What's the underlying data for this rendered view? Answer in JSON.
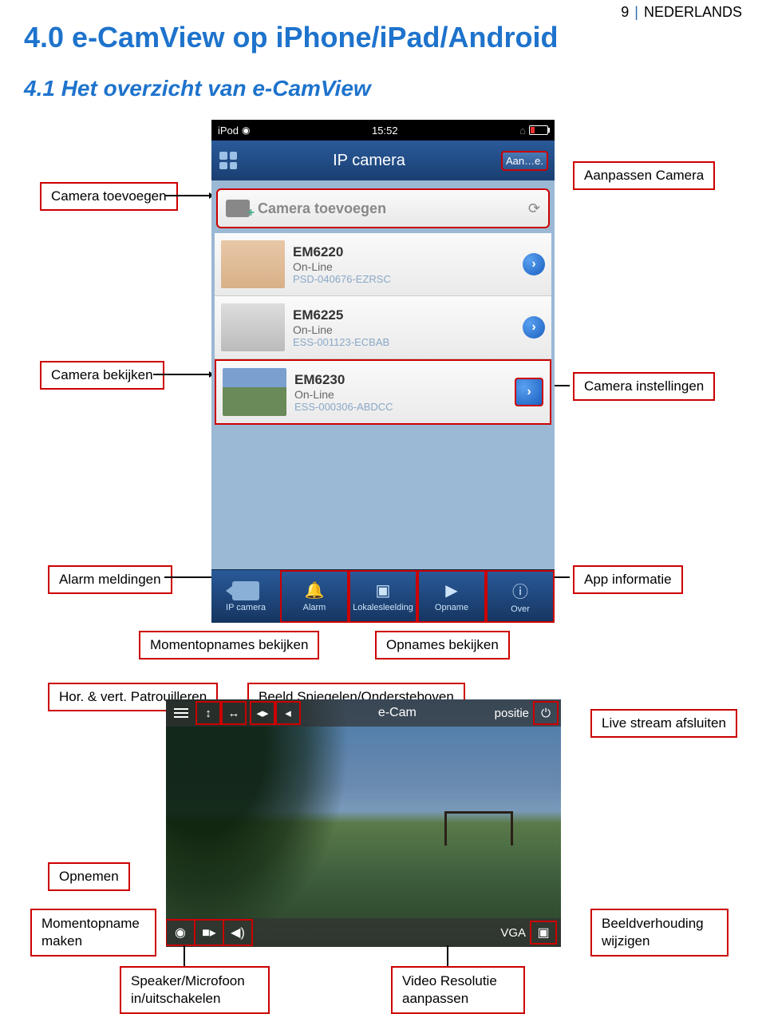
{
  "page": {
    "number": "9",
    "language": "NEDERLANDS"
  },
  "headings": {
    "h1": "4.0 e-CamView op iPhone/iPad/Android",
    "h2": "4.1 Het overzicht van e-CamView"
  },
  "callouts": {
    "camera_toevoegen": "Camera toevoegen",
    "aanpassen_camera": "Aanpassen Camera",
    "camera_bekijken": "Camera bekijken",
    "camera_instellingen": "Camera instellingen",
    "alarm_meldingen": "Alarm meldingen",
    "app_informatie": "App informatie",
    "momentopnames_bekijken": "Momentopnames bekijken",
    "opnames_bekijken": "Opnames bekijken",
    "patrouilleren": "Hor. & vert. Patrouilleren",
    "spiegelen": "Beeld Spiegelen/Ondersteboven",
    "live_afsluiten": "Live stream afsluiten",
    "opnemen": "Opnemen",
    "momentopname_maken": "Momentopname maken",
    "beeldverhouding": "Beeldverhouding wijzigen",
    "speaker": "Speaker/Microfoon in/uitschakelen",
    "resolutie": "Video Resolutie aanpassen"
  },
  "phone": {
    "statusbar": {
      "device": "iPod",
      "time": "15:52"
    },
    "navbar": {
      "title": "IP camera",
      "button": "Aan…e."
    },
    "add_row": {
      "label": "Camera toevoegen"
    },
    "cameras": [
      {
        "name": "EM6220",
        "status": "On-Line",
        "code": "PSD-040676-EZRSC"
      },
      {
        "name": "EM6225",
        "status": "On-Line",
        "code": "ESS-001123-ECBAB"
      },
      {
        "name": "EM6230",
        "status": "On-Line",
        "code": "ESS-000306-ABDCC"
      }
    ],
    "tabs": [
      {
        "label": "IP camera"
      },
      {
        "label": "Alarm"
      },
      {
        "label": "Lokalesleelding"
      },
      {
        "label": "Opname"
      },
      {
        "label": "Over"
      }
    ]
  },
  "live": {
    "title": "e-Cam",
    "position": "positie",
    "vga": "VGA"
  }
}
